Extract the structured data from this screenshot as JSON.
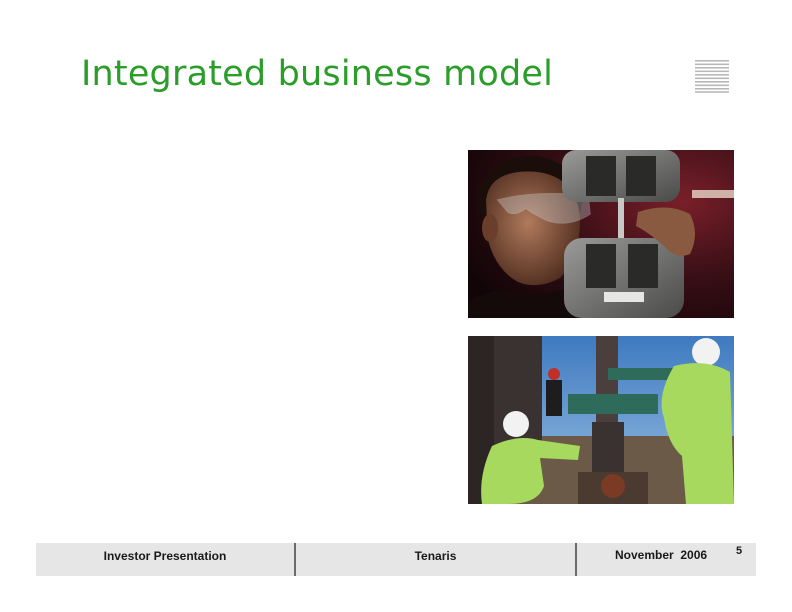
{
  "slide": {
    "title": "Integrated business model"
  },
  "images": {
    "lab_photo": "Technician with safety glasses operating tensile testing machine",
    "rig_photo": "Tenaris field crew in green coveralls and white hard hats working on drilling rig"
  },
  "footer": {
    "left": "Investor Presentation",
    "center": "Tenaris",
    "right": "November  2006",
    "page_number": "5"
  },
  "colors": {
    "title": "#2a9d2a",
    "footer_bg": "#e6e6e6",
    "divider": "#6b6b6b"
  }
}
